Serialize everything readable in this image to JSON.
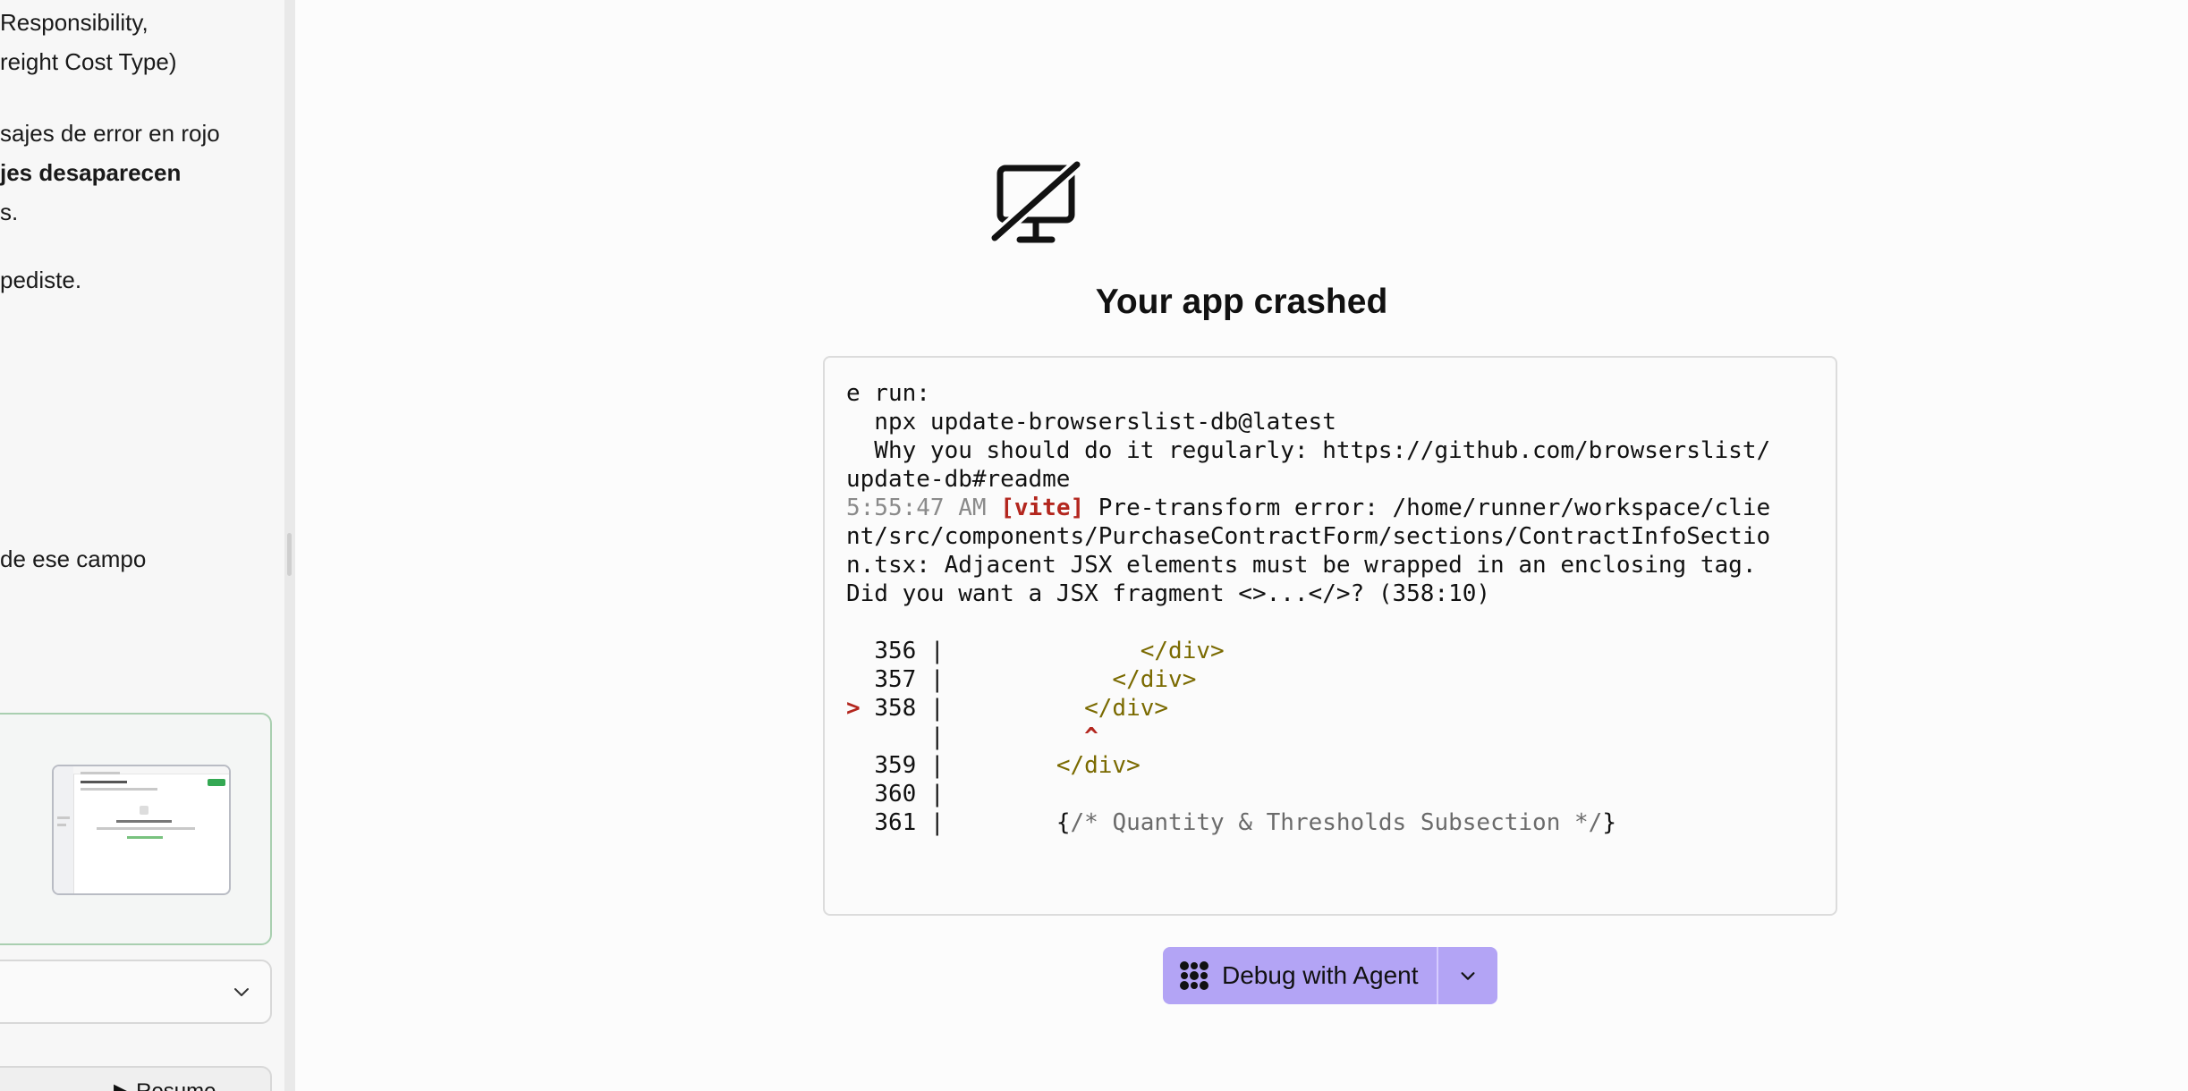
{
  "chat": {
    "lines": [
      {
        "text": " Responsibility,",
        "bold": false
      },
      {
        "text": "reight Cost Type)",
        "bold": false
      },
      {
        "text": "sajes de error en rojo",
        "bold": false
      },
      {
        "text": "jes desaparecen",
        "bold": true
      },
      {
        "text": "s.",
        "bold": false
      },
      {
        "text": "pediste.",
        "bold": false
      },
      {
        "text": "de ese campo",
        "bold": false
      }
    ],
    "resume_label": "▶ Resume"
  },
  "crash": {
    "title": "Your app crashed",
    "icon": "monitor-off-icon"
  },
  "log": {
    "intro_lines": [
      "e run:",
      "  npx update-browserslist-db@latest",
      "  Why you should do it regularly: https://github.com/browserslist/",
      "update-db#readme"
    ],
    "time": "5:55:47 AM",
    "source": "[vite]",
    "error_lines": [
      "Pre-transform error: /home/runner/workspace/clie",
      "nt/src/components/PurchaseContractForm/sections/ContractInfoSectio",
      "n.tsx: Adjacent JSX elements must be wrapped in an enclosing tag.",
      "Did you want a JSX fragment <>...</>? (358:10)"
    ],
    "code_lines": [
      {
        "marker": " ",
        "num": "356",
        "code": "              </div>",
        "kind": "tag"
      },
      {
        "marker": " ",
        "num": "357",
        "code": "            </div>",
        "kind": "tag"
      },
      {
        "marker": ">",
        "num": "358",
        "code": "          </div>",
        "kind": "tag"
      },
      {
        "marker": " ",
        "num": "",
        "code": "          ^",
        "kind": "caret"
      },
      {
        "marker": " ",
        "num": "359",
        "code": "        </div>",
        "kind": "tag"
      },
      {
        "marker": " ",
        "num": "360",
        "code": "",
        "kind": "plain"
      },
      {
        "marker": " ",
        "num": "361",
        "code": "        {/* Quantity & Thresholds Subsection */}",
        "kind": "comment"
      }
    ]
  },
  "debug": {
    "label": "Debug with Agent",
    "icon": "agent-icon",
    "dropdown_icon": "chevron-down-icon",
    "accent": "#b3a4f5"
  }
}
